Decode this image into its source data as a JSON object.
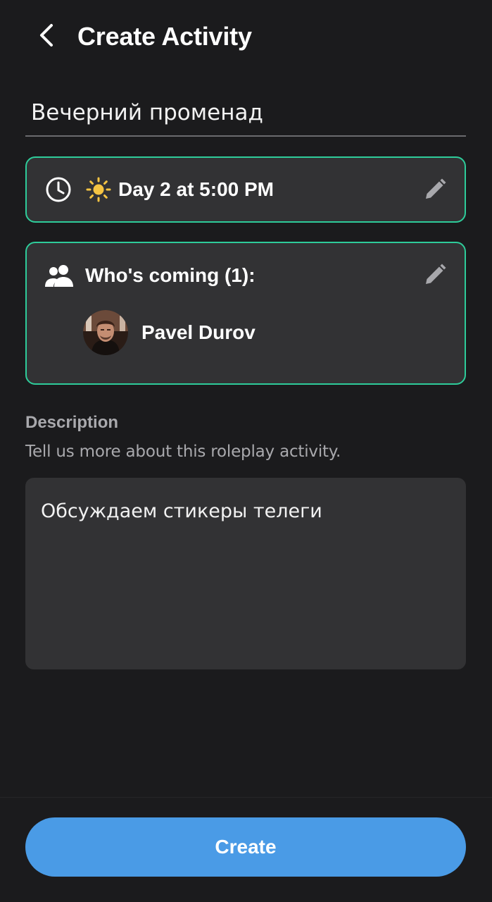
{
  "header": {
    "title": "Create Activity",
    "back_icon": "chevron-left-icon"
  },
  "activity": {
    "name": "Вечерний променад"
  },
  "time_card": {
    "text": "Day 2 at 5:00 PM",
    "icons": [
      "clock-icon",
      "sun-icon",
      "pencil-icon"
    ]
  },
  "people_card": {
    "title": "Who's coming (1):",
    "icons": [
      "group-icon",
      "pencil-icon"
    ],
    "attendees": [
      {
        "name": "Pavel Durov"
      }
    ]
  },
  "description": {
    "label": "Description",
    "hint": "Tell us more about this roleplay activity.",
    "value": "Обсуждаем стикеры телеги"
  },
  "footer": {
    "create_label": "Create"
  },
  "colors": {
    "background": "#1b1b1d",
    "card": "#323234",
    "accent_border": "#2ecc9a",
    "primary_button": "#4a9be6",
    "sun": "#f5c443",
    "muted_text": "#a9a9ad"
  }
}
